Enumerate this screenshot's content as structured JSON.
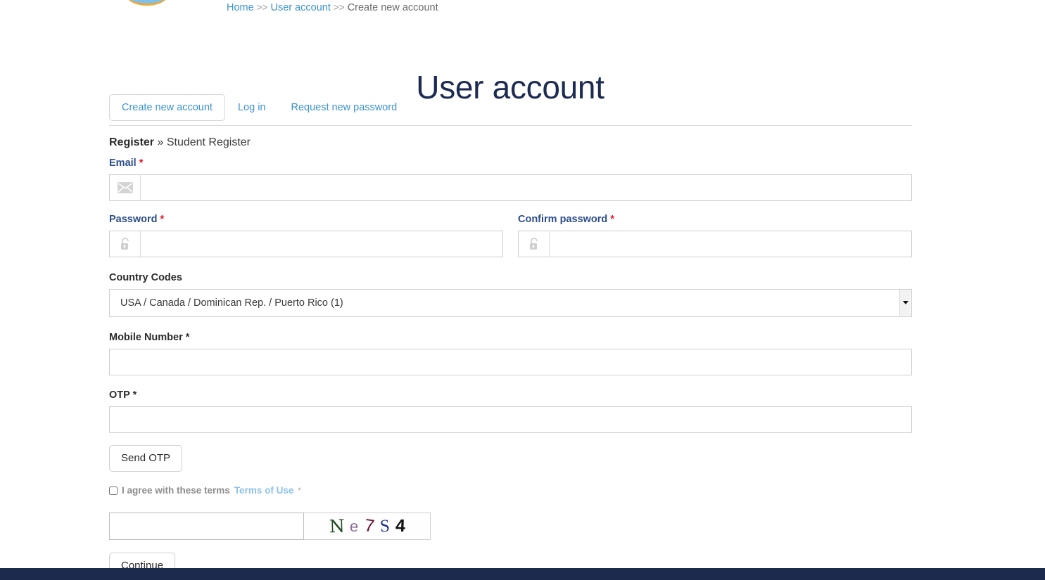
{
  "brand": {
    "logo_name": "site-logo",
    "logo_color": "#7dc0ec",
    "logo_accent": "#f0a830"
  },
  "breadcrumb": {
    "home": "Home",
    "sep": ">>",
    "user_account": "User account",
    "current": "Create new account"
  },
  "page": {
    "title": "User account"
  },
  "tabs": [
    {
      "label": "Create new account",
      "active": true
    },
    {
      "label": "Log in",
      "active": false
    },
    {
      "label": "Request new password",
      "active": false
    }
  ],
  "register": {
    "heading_strong": "Register",
    "heading_rest": "» Student Register"
  },
  "fields": {
    "email": {
      "label": "Email",
      "required_mark": "*",
      "value": "",
      "placeholder": "",
      "icon": "envelope-icon"
    },
    "password": {
      "label": "Password",
      "required_mark": "*",
      "value": "",
      "placeholder": "",
      "icon": "lock-icon"
    },
    "confirm_password": {
      "label": "Confirm password",
      "required_mark": "*",
      "value": "",
      "placeholder": "",
      "icon": "lock-icon"
    },
    "country_codes": {
      "label": "Country Codes",
      "selected": "USA / Canada / Dominican Rep. / Puerto Rico (1)",
      "options": [
        "USA / Canada / Dominican Rep. / Puerto Rico (1)"
      ]
    },
    "mobile_number": {
      "label": "Mobile Number *",
      "value": "",
      "placeholder": ""
    },
    "otp": {
      "label": "OTP *",
      "value": "",
      "placeholder": ""
    }
  },
  "buttons": {
    "send_otp": "Send OTP",
    "continue": "Continue"
  },
  "terms": {
    "checked": false,
    "text": "I agree with these terms",
    "link": "Terms of Use",
    "required_mark": "*"
  },
  "captcha": {
    "value": "",
    "placeholder": "",
    "characters": [
      {
        "char": "N",
        "color": "#1f4b20"
      },
      {
        "char": "e",
        "color": "#8a6d96"
      },
      {
        "char": "7",
        "color": "#6d1030"
      },
      {
        "char": "S",
        "color": "#1d2f8a"
      },
      {
        "char": "4",
        "color": "#111111"
      }
    ]
  },
  "colors": {
    "accent_link": "#3b92d1",
    "title": "#1d2b53",
    "label_blue": "#2d4e8a",
    "required_red": "#e8122b",
    "footer": "#1c2a4d"
  }
}
